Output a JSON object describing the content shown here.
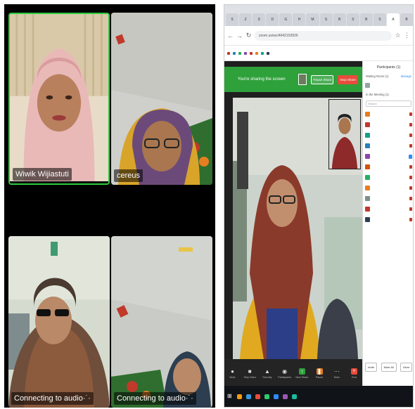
{
  "gallery": {
    "tiles": [
      {
        "name": "Wiwik Wijiastuti",
        "active_speaker": true
      },
      {
        "name": "cereus"
      },
      {
        "name": "Connecting to audio·˙·"
      },
      {
        "name": "Connecting to audio·˙·"
      }
    ]
  },
  "browser": {
    "tabs": [
      "S",
      "Z",
      "S",
      "D",
      "G",
      "H",
      "M",
      "S",
      "B",
      "S",
      "B",
      "S",
      "A",
      "B"
    ],
    "url": "zoom.us/wc/4642153926"
  },
  "zoom": {
    "share_banner": {
      "message": "You're sharing the screen",
      "pause_label": "Pause Share",
      "stop_label": "Stop Share"
    },
    "toolbar": [
      {
        "icon": "mic-icon",
        "label": "Mute"
      },
      {
        "icon": "video-icon",
        "label": "Stop Video"
      },
      {
        "icon": "security-icon",
        "label": "Security"
      },
      {
        "icon": "participants-icon",
        "label": "Participants"
      },
      {
        "icon": "new-share-icon",
        "label": "New Share"
      },
      {
        "icon": "pause-share-icon",
        "label": "Pause"
      },
      {
        "icon": "more-icon",
        "label": "More"
      },
      {
        "icon": "end-icon",
        "label": "End"
      }
    ],
    "participants": {
      "title": "Participants (1)",
      "waiting": "Waiting Room (1)",
      "manage": "Manage",
      "in_meeting": "In the Meeting (1)",
      "search_placeholder": "Search",
      "invite": "Invite",
      "mute_all": "Mute All",
      "more": "More"
    }
  },
  "colors": {
    "zoom_green": "#2fa13b",
    "zoom_blue": "#2d8cff",
    "end_red": "#e74c3c",
    "active_border": "#2ecc40"
  }
}
